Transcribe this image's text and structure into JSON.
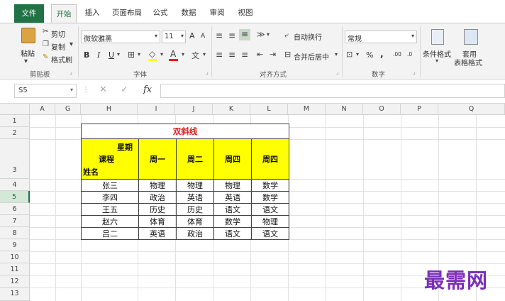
{
  "tabs": [
    "文件",
    "开始",
    "插入",
    "页面布局",
    "公式",
    "数据",
    "审阅",
    "视图"
  ],
  "clipboard": {
    "paste": "粘贴",
    "cut": "剪切",
    "copy": "复制",
    "format_painter": "格式刷",
    "group_label": "剪贴板"
  },
  "font": {
    "name": "微软雅黑",
    "size": "11",
    "grow": "A",
    "shrink": "A",
    "bold": "B",
    "italic": "I",
    "underline": "U",
    "group_label": "字体",
    "font_color": "#ff0000",
    "fill_color": "#ffff00"
  },
  "alignment": {
    "wrap_text": "自动换行",
    "merge_center": "合并后居中",
    "group_label": "对齐方式"
  },
  "number": {
    "format": "常规",
    "percent": "%",
    "comma": ",",
    "inc_decimal": ".00",
    "dec_decimal": ".0",
    "group_label": "数字"
  },
  "styles": {
    "conditional": "条件格式",
    "table_format_1": "套用",
    "table_format_2": "表格格式"
  },
  "formula_bar": {
    "name_box": "S5",
    "fx": "fx",
    "content": ""
  },
  "columns": [
    "A",
    "G",
    "H",
    "I",
    "J",
    "K",
    "L",
    "M",
    "N",
    "O",
    "P",
    "Q"
  ],
  "rows": [
    "1",
    "2",
    "3",
    "4",
    "5",
    "6",
    "7",
    "8",
    "9",
    "10",
    "11",
    "12",
    "13"
  ],
  "selected_row": "5",
  "sheet_table": {
    "title": "双斜线",
    "title_color": "#e02020",
    "corner": {
      "top": "星期",
      "middle": "课程",
      "bottom": "姓名"
    },
    "days": [
      "周一",
      "周二",
      "周四",
      "周四"
    ],
    "data": [
      [
        "张三",
        "物理",
        "物理",
        "物理",
        "数学"
      ],
      [
        "李四",
        "政治",
        "英语",
        "英语",
        "数学"
      ],
      [
        "王五",
        "历史",
        "历史",
        "语文",
        "语文"
      ],
      [
        "赵六",
        "体育",
        "体育",
        "数学",
        "物理"
      ],
      [
        "吕二",
        "英语",
        "政治",
        "语文",
        "语文"
      ]
    ]
  },
  "watermark": "最需网",
  "accent": "#217346"
}
